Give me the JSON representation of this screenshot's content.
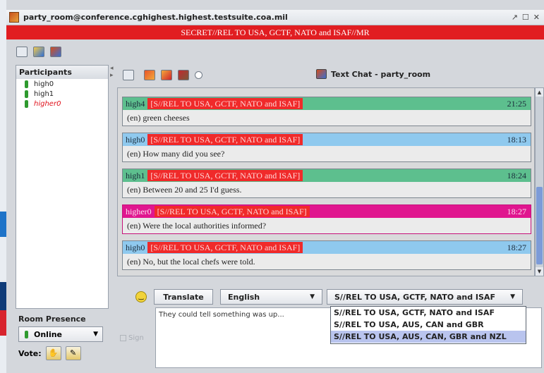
{
  "window": {
    "title": "party_room@conference.cghighest.highest.testsuite.coa.mil",
    "controls": [
      "↗",
      "☐",
      "✕"
    ]
  },
  "banner": {
    "text": "SECRET//REL TO USA, GCTF, NATO and ISAF//MR"
  },
  "participants": {
    "header": "Participants",
    "items": [
      {
        "name": "high0",
        "self": false
      },
      {
        "name": "high1",
        "self": false
      },
      {
        "name": "higher0",
        "self": true
      }
    ]
  },
  "room_presence": {
    "title": "Room Presence",
    "status": "Online",
    "vote_label": "Vote:"
  },
  "chat": {
    "title": "Text Chat - party_room",
    "messages": [
      {
        "user": "high4",
        "classification": "[S//REL TO USA, GCTF, NATO and ISAF]",
        "time": "21:25",
        "text": "(en) green cheeses",
        "color": "green"
      },
      {
        "user": "high0",
        "classification": "[S//REL TO USA, GCTF, NATO and ISAF]",
        "time": "18:13",
        "text": "(en) How many did you see?",
        "color": "blue"
      },
      {
        "user": "high1",
        "classification": "[S//REL TO USA, GCTF, NATO and ISAF]",
        "time": "18:24",
        "text": "(en) Between 20 and 25 I'd guess.",
        "color": "green"
      },
      {
        "user": "higher0",
        "classification": "[S//REL TO USA, GCTF, NATO and ISAF]",
        "time": "18:27",
        "text": "(en) Were the local authorities informed?",
        "color": "pink"
      },
      {
        "user": "high0",
        "classification": "[S//REL TO USA, GCTF, NATO and ISAF]",
        "time": "18:27",
        "text": "(en) No, but the local chefs were told.",
        "color": "blue"
      }
    ]
  },
  "compose": {
    "translate_label": "Translate",
    "language": "English",
    "classification": "S//REL TO USA, GCTF, NATO and ISAF",
    "classification_options": [
      "S//REL TO USA, GCTF, NATO and ISAF",
      "S//REL TO USA, AUS, CAN and GBR",
      "S//REL TO USA, AUS, CAN, GBR and NZL"
    ],
    "draft_text": "They could tell something was up...",
    "sign_label": "Sign"
  },
  "colors": {
    "banner": "#e11d21",
    "green": "#5dbf8e",
    "blue": "#8fc9ee",
    "pink": "#e0168f",
    "classification_tag": "#f02a2a"
  }
}
